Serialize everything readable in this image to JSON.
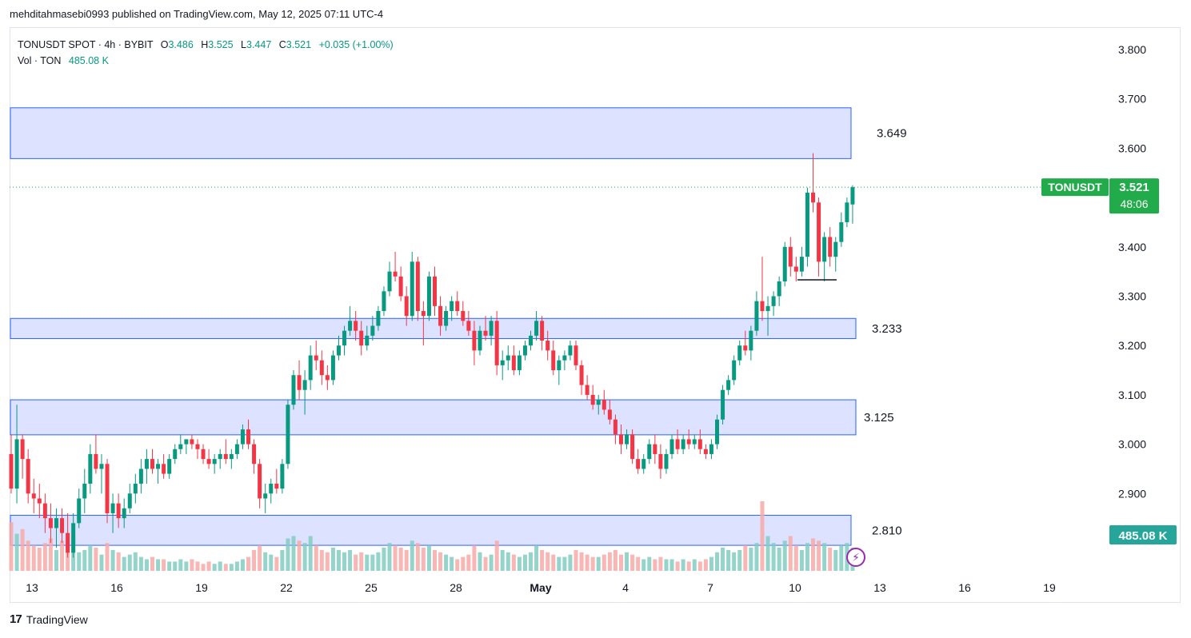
{
  "header": {
    "text": "mehditahmasebi0993 published on TradingView.com, May 12, 2025 07:11 UTC-4"
  },
  "legend": {
    "symbol": "TONUSDT SPOT · 4h · BYBIT",
    "o_label": "O",
    "o_value": "3.486",
    "h_label": "H",
    "h_value": "3.525",
    "l_label": "L",
    "l_value": "3.447",
    "c_label": "C",
    "c_value": "3.521",
    "change": "+0.035 (+1.00%)",
    "vol_label": "Vol · TON",
    "vol_value": "485.08 K"
  },
  "price_tag": {
    "symbol": "TONUSDT",
    "price": "3.521",
    "countdown": "48:06"
  },
  "volume_tag": "485.08 K",
  "footer": {
    "logo": "17",
    "brand": "TradingView"
  },
  "colors": {
    "up": "#089981",
    "down": "#f23645",
    "zone_fill": "#d6ddff",
    "zone_stroke": "#2962ff",
    "tag_green": "#22ab4a"
  },
  "icons": {
    "alert": "lightning-icon",
    "logo": "tradingview-logo-icon"
  },
  "chart_data": {
    "type": "candlestick",
    "timeframe": "4h",
    "y_ticks": [
      "3.800",
      "3.700",
      "3.600",
      "3.400",
      "3.300",
      "3.200",
      "3.100",
      "3.000",
      "2.900"
    ],
    "x_ticks": [
      "13",
      "16",
      "19",
      "22",
      "25",
      "28",
      "May",
      "4",
      "7",
      "10",
      "13",
      "16",
      "19"
    ],
    "ylim": [
      2.79,
      3.84
    ],
    "zones": [
      {
        "label": "3.649",
        "top": 3.682,
        "bottom": 3.579
      },
      {
        "label": "3.233",
        "top": 3.255,
        "bottom": 3.214
      },
      {
        "label": "3.125",
        "top": 3.09,
        "bottom": 3.019
      },
      {
        "label": "2.810",
        "top": 2.856,
        "bottom": 2.795
      }
    ],
    "candles": [
      [
        2.98,
        3.02,
        2.9,
        2.91
      ],
      [
        2.91,
        3.08,
        2.88,
        3.01
      ],
      [
        3.01,
        3.02,
        2.93,
        2.97
      ],
      [
        2.97,
        2.99,
        2.88,
        2.9
      ],
      [
        2.9,
        2.93,
        2.86,
        2.89
      ],
      [
        2.89,
        2.92,
        2.85,
        2.88
      ],
      [
        2.88,
        2.9,
        2.82,
        2.85
      ],
      [
        2.85,
        2.88,
        2.8,
        2.83
      ],
      [
        2.83,
        2.87,
        2.79,
        2.85
      ],
      [
        2.85,
        2.87,
        2.8,
        2.82
      ],
      [
        2.82,
        2.86,
        2.77,
        2.78
      ],
      [
        2.78,
        2.86,
        2.77,
        2.84
      ],
      [
        2.84,
        2.91,
        2.83,
        2.89
      ],
      [
        2.89,
        2.95,
        2.86,
        2.92
      ],
      [
        2.92,
        3.0,
        2.9,
        2.98
      ],
      [
        2.98,
        3.02,
        2.94,
        2.95
      ],
      [
        2.95,
        2.98,
        2.9,
        2.96
      ],
      [
        2.96,
        2.97,
        2.84,
        2.86
      ],
      [
        2.86,
        2.9,
        2.82,
        2.88
      ],
      [
        2.88,
        2.9,
        2.83,
        2.85
      ],
      [
        2.85,
        2.89,
        2.83,
        2.87
      ],
      [
        2.87,
        2.92,
        2.86,
        2.9
      ],
      [
        2.9,
        2.94,
        2.88,
        2.92
      ],
      [
        2.92,
        2.97,
        2.9,
        2.95
      ],
      [
        2.95,
        2.99,
        2.92,
        2.97
      ],
      [
        2.97,
        2.99,
        2.94,
        2.95
      ],
      [
        2.95,
        2.97,
        2.92,
        2.96
      ],
      [
        2.96,
        2.98,
        2.93,
        2.94
      ],
      [
        2.94,
        2.98,
        2.93,
        2.97
      ],
      [
        2.97,
        3.0,
        2.96,
        2.99
      ],
      [
        2.99,
        3.02,
        2.98,
        3.0
      ],
      [
        3.0,
        3.01,
        2.98,
        3.01
      ],
      [
        3.01,
        3.02,
        2.99,
        3.0
      ],
      [
        3.0,
        3.01,
        2.97,
        2.99
      ],
      [
        2.99,
        3.0,
        2.96,
        2.97
      ],
      [
        2.97,
        2.99,
        2.95,
        2.96
      ],
      [
        2.96,
        2.98,
        2.94,
        2.97
      ],
      [
        2.97,
        2.99,
        2.95,
        2.98
      ],
      [
        2.98,
        3.01,
        2.96,
        2.97
      ],
      [
        2.97,
        2.99,
        2.95,
        2.98
      ],
      [
        2.98,
        3.01,
        2.97,
        3.0
      ],
      [
        3.0,
        3.04,
        2.99,
        3.03
      ],
      [
        3.03,
        3.05,
        2.99,
        3.0
      ],
      [
        3.0,
        3.01,
        2.94,
        2.96
      ],
      [
        2.96,
        2.97,
        2.87,
        2.89
      ],
      [
        2.89,
        2.92,
        2.86,
        2.9
      ],
      [
        2.9,
        2.93,
        2.88,
        2.92
      ],
      [
        2.92,
        2.95,
        2.9,
        2.91
      ],
      [
        2.91,
        2.97,
        2.9,
        2.96
      ],
      [
        2.96,
        3.09,
        2.95,
        3.08
      ],
      [
        3.08,
        3.15,
        3.07,
        3.14
      ],
      [
        3.14,
        3.17,
        3.09,
        3.11
      ],
      [
        3.11,
        3.15,
        3.06,
        3.13
      ],
      [
        3.13,
        3.2,
        3.11,
        3.18
      ],
      [
        3.18,
        3.21,
        3.15,
        3.17
      ],
      [
        3.17,
        3.19,
        3.12,
        3.14
      ],
      [
        3.14,
        3.16,
        3.11,
        3.13
      ],
      [
        3.13,
        3.19,
        3.12,
        3.18
      ],
      [
        3.18,
        3.22,
        3.17,
        3.2
      ],
      [
        3.2,
        3.24,
        3.18,
        3.23
      ],
      [
        3.23,
        3.28,
        3.22,
        3.25
      ],
      [
        3.25,
        3.27,
        3.21,
        3.23
      ],
      [
        3.23,
        3.25,
        3.18,
        3.2
      ],
      [
        3.2,
        3.24,
        3.19,
        3.22
      ],
      [
        3.22,
        3.26,
        3.21,
        3.24
      ],
      [
        3.24,
        3.28,
        3.23,
        3.27
      ],
      [
        3.27,
        3.32,
        3.26,
        3.31
      ],
      [
        3.31,
        3.37,
        3.3,
        3.35
      ],
      [
        3.35,
        3.39,
        3.33,
        3.34
      ],
      [
        3.34,
        3.36,
        3.29,
        3.3
      ],
      [
        3.3,
        3.32,
        3.24,
        3.26
      ],
      [
        3.26,
        3.39,
        3.25,
        3.37
      ],
      [
        3.37,
        3.38,
        3.25,
        3.27
      ],
      [
        3.27,
        3.29,
        3.2,
        3.26
      ],
      [
        3.26,
        3.35,
        3.25,
        3.34
      ],
      [
        3.34,
        3.36,
        3.26,
        3.28
      ],
      [
        3.28,
        3.3,
        3.22,
        3.24
      ],
      [
        3.24,
        3.28,
        3.23,
        3.27
      ],
      [
        3.27,
        3.3,
        3.25,
        3.29
      ],
      [
        3.29,
        3.31,
        3.26,
        3.27
      ],
      [
        3.27,
        3.29,
        3.24,
        3.25
      ],
      [
        3.25,
        3.27,
        3.22,
        3.23
      ],
      [
        3.23,
        3.25,
        3.16,
        3.19
      ],
      [
        3.19,
        3.24,
        3.18,
        3.23
      ],
      [
        3.23,
        3.26,
        3.21,
        3.22
      ],
      [
        3.22,
        3.26,
        3.2,
        3.25
      ],
      [
        3.25,
        3.27,
        3.14,
        3.16
      ],
      [
        3.16,
        3.19,
        3.13,
        3.17
      ],
      [
        3.17,
        3.2,
        3.15,
        3.18
      ],
      [
        3.18,
        3.2,
        3.14,
        3.15
      ],
      [
        3.15,
        3.19,
        3.14,
        3.18
      ],
      [
        3.18,
        3.21,
        3.17,
        3.2
      ],
      [
        3.2,
        3.23,
        3.19,
        3.22
      ],
      [
        3.22,
        3.27,
        3.21,
        3.25
      ],
      [
        3.25,
        3.26,
        3.19,
        3.21
      ],
      [
        3.21,
        3.23,
        3.17,
        3.19
      ],
      [
        3.19,
        3.21,
        3.14,
        3.15
      ],
      [
        3.15,
        3.18,
        3.12,
        3.17
      ],
      [
        3.17,
        3.19,
        3.15,
        3.18
      ],
      [
        3.18,
        3.21,
        3.17,
        3.2
      ],
      [
        3.2,
        3.21,
        3.15,
        3.16
      ],
      [
        3.16,
        3.17,
        3.1,
        3.12
      ],
      [
        3.12,
        3.14,
        3.09,
        3.1
      ],
      [
        3.1,
        3.12,
        3.07,
        3.08
      ],
      [
        3.08,
        3.1,
        3.06,
        3.09
      ],
      [
        3.09,
        3.11,
        3.06,
        3.07
      ],
      [
        3.07,
        3.09,
        3.04,
        3.05
      ],
      [
        3.05,
        3.06,
        3.0,
        3.02
      ],
      [
        3.02,
        3.04,
        2.98,
        3.0
      ],
      [
        3.0,
        3.03,
        2.99,
        3.02
      ],
      [
        3.02,
        3.03,
        2.96,
        2.97
      ],
      [
        2.97,
        2.99,
        2.94,
        2.95
      ],
      [
        2.95,
        2.98,
        2.94,
        2.97
      ],
      [
        2.97,
        3.01,
        2.96,
        3.0
      ],
      [
        3.0,
        3.02,
        2.96,
        2.98
      ],
      [
        2.98,
        3.0,
        2.93,
        2.95
      ],
      [
        2.95,
        2.99,
        2.94,
        2.98
      ],
      [
        2.98,
        3.02,
        2.97,
        3.01
      ],
      [
        3.01,
        3.03,
        2.98,
        2.99
      ],
      [
        2.99,
        3.02,
        2.98,
        3.01
      ],
      [
        3.01,
        3.03,
        2.99,
        3.0
      ],
      [
        3.0,
        3.02,
        2.99,
        3.01
      ],
      [
        3.01,
        3.03,
        2.98,
        2.99
      ],
      [
        2.99,
        3.0,
        2.97,
        2.98
      ],
      [
        2.98,
        3.01,
        2.97,
        3.0
      ],
      [
        3.0,
        3.06,
        2.99,
        3.05
      ],
      [
        3.05,
        3.12,
        3.04,
        3.11
      ],
      [
        3.11,
        3.14,
        3.1,
        3.13
      ],
      [
        3.13,
        3.18,
        3.12,
        3.17
      ],
      [
        3.17,
        3.21,
        3.16,
        3.2
      ],
      [
        3.2,
        3.23,
        3.18,
        3.19
      ],
      [
        3.19,
        3.24,
        3.17,
        3.23
      ],
      [
        3.23,
        3.31,
        3.22,
        3.29
      ],
      [
        3.29,
        3.38,
        3.25,
        3.27
      ],
      [
        3.27,
        3.3,
        3.22,
        3.28
      ],
      [
        3.28,
        3.31,
        3.26,
        3.3
      ],
      [
        3.3,
        3.34,
        3.28,
        3.33
      ],
      [
        3.33,
        3.41,
        3.32,
        3.4
      ],
      [
        3.4,
        3.42,
        3.34,
        3.36
      ],
      [
        3.36,
        3.38,
        3.33,
        3.35
      ],
      [
        3.35,
        3.4,
        3.34,
        3.38
      ],
      [
        3.38,
        3.52,
        3.36,
        3.51
      ],
      [
        3.51,
        3.59,
        3.47,
        3.49
      ],
      [
        3.49,
        3.5,
        3.34,
        3.37
      ],
      [
        3.37,
        3.43,
        3.33,
        3.42
      ],
      [
        3.42,
        3.44,
        3.36,
        3.38
      ],
      [
        3.38,
        3.42,
        3.35,
        3.41
      ],
      [
        3.41,
        3.47,
        3.4,
        3.45
      ],
      [
        3.45,
        3.5,
        3.44,
        3.49
      ],
      [
        3.486,
        3.525,
        3.447,
        3.521
      ]
    ],
    "volume": [
      "2.1M",
      "1.6M",
      "1.8M",
      "1.3M",
      "1.1M",
      "1.0M",
      "1.2M",
      "1.4M",
      "0.9M",
      "1.3M",
      "1.2M",
      "1.5M",
      "0.8M",
      "0.9M",
      "1.1M",
      "1.0M",
      "0.7M",
      "1.2M",
      "0.9M",
      "0.8M",
      "0.6M",
      "0.7M",
      "0.8M",
      "0.6M",
      "0.5M",
      "0.6M",
      "0.5M",
      "0.5M",
      "0.4M",
      "0.4M",
      "0.5M",
      "0.4M",
      "0.5M",
      "0.4M",
      "0.3M",
      "0.4M",
      "0.3M",
      "0.4M",
      "0.3M",
      "0.3M",
      "0.4M",
      "0.5M",
      "0.6M",
      "0.9M",
      "1.1M",
      "0.8M",
      "0.7M",
      "0.6M",
      "0.9M",
      "1.4M",
      "1.5M",
      "1.3M",
      "1.2M",
      "1.5M",
      "1.1M",
      "0.9M",
      "0.8M",
      "1.0M",
      "0.9M",
      "0.8M",
      "0.9M",
      "0.7M",
      "0.8M",
      "0.7M",
      "0.7M",
      "0.8M",
      "1.0M",
      "1.2M",
      "1.1M",
      "1.0M",
      "0.9M",
      "1.3M",
      "1.2M",
      "1.0M",
      "1.1M",
      "0.9M",
      "0.8M",
      "0.7M",
      "0.6M",
      "0.5M",
      "0.6M",
      "0.7M",
      "1.1M",
      "0.8M",
      "0.6M",
      "0.7M",
      "1.3M",
      "0.9M",
      "0.8M",
      "0.7M",
      "0.6M",
      "0.7M",
      "0.8M",
      "1.1M",
      "0.9M",
      "0.8M",
      "0.7M",
      "0.6M",
      "0.6M",
      "0.7M",
      "0.9M",
      "0.8M",
      "0.7M",
      "0.6M",
      "0.6M",
      "0.7M",
      "0.8M",
      "0.9M",
      "0.7M",
      "0.8M",
      "0.7M",
      "0.6M",
      "0.5M",
      "0.6M",
      "0.5M",
      "0.6M",
      "0.5M",
      "0.5M",
      "0.4M",
      "0.5M",
      "0.4M",
      "0.5M",
      "0.4M",
      "0.5M",
      "0.6M",
      "0.8M",
      "1.0M",
      "0.9M",
      "0.8M",
      "0.9M",
      "1.1M",
      "1.0M",
      "1.2M",
      "3.0M",
      "1.5M",
      "1.2M",
      "1.0M",
      "1.3M",
      "1.5M",
      "1.1M",
      "0.9M",
      "1.2M",
      "1.4M",
      "1.3M",
      "1.2M",
      "1.0M",
      "0.9M",
      "1.1M",
      "1.2M",
      "1.0M"
    ]
  }
}
